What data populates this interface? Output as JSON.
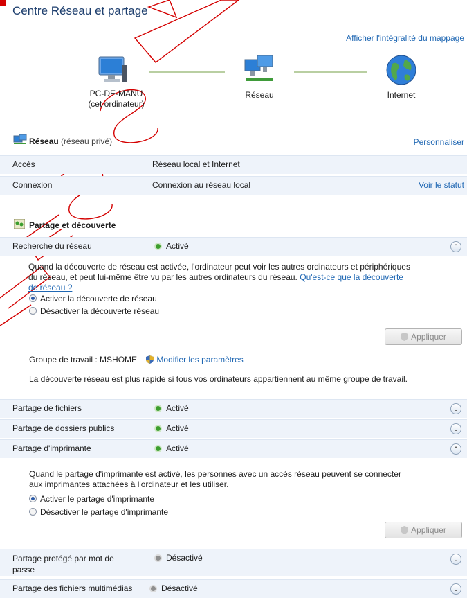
{
  "window": {
    "title": "Centre Réseau et partage"
  },
  "map_link": "Afficher l'intégralité du mappage",
  "network_map": {
    "computer": {
      "name": "PC-DE-MANU",
      "subtitle": "(cet ordinateur)"
    },
    "network": {
      "name": "Réseau"
    },
    "internet": {
      "name": "Internet"
    }
  },
  "network_section": {
    "name": "Réseau",
    "type": "(réseau privé)",
    "customize_link": "Personnaliser",
    "rows": [
      {
        "label": "Accès",
        "value": "Réseau local et Internet"
      },
      {
        "label": "Connexion",
        "value": "Connexion au réseau local",
        "link": "Voir le statut"
      }
    ]
  },
  "sharing_section": {
    "title": "Partage et découverte",
    "rows": {
      "discovery": {
        "label": "Recherche du réseau",
        "status": "Activé"
      },
      "files": {
        "label": "Partage de fichiers",
        "status": "Activé"
      },
      "public": {
        "label": "Partage de dossiers publics",
        "status": "Activé"
      },
      "printer": {
        "label": "Partage d'imprimante",
        "status": "Activé"
      },
      "password_l1": "Partage protégé par mot de",
      "password_l2": "passe",
      "password_status": "Désactivé",
      "media": {
        "label": "Partage des fichiers multimédias",
        "status": "Désactivé"
      }
    },
    "discovery_panel": {
      "desc_l1": "Quand la découverte de réseau est activée, l'ordinateur peut voir les autres ordinateurs et périphériques",
      "desc_l2": "du réseau, et peut lui-même être vu par les autres ordinateurs du réseau.",
      "help_l1": "Qu'est-ce que la découverte",
      "help_l2": "de réseau ?",
      "option_on": "Activer la découverte de réseau",
      "option_off": "Désactiver la découverte réseau",
      "apply": "Appliquer",
      "workgroup": "Groupe de travail : MSHOME",
      "modify_link": "Modifier les paramètres",
      "tip": "La découverte réseau est plus rapide si tous vos ordinateurs appartiennent au même groupe de travail."
    },
    "printer_panel": {
      "desc_l1": "Quand le partage d'imprimante est activé, les personnes avec un accès réseau peuvent se connecter",
      "desc_l2": "aux imprimantes attachées à l'ordinateur et les utiliser.",
      "option_on": "Activer le partage d'imprimante",
      "option_off": "Désactiver le partage d'imprimante",
      "apply": "Appliquer"
    }
  },
  "colors": {
    "link": "#1f67b3",
    "active": "#3c9e2e",
    "inactive": "#8e8e8e",
    "watermark": "#d40000"
  }
}
